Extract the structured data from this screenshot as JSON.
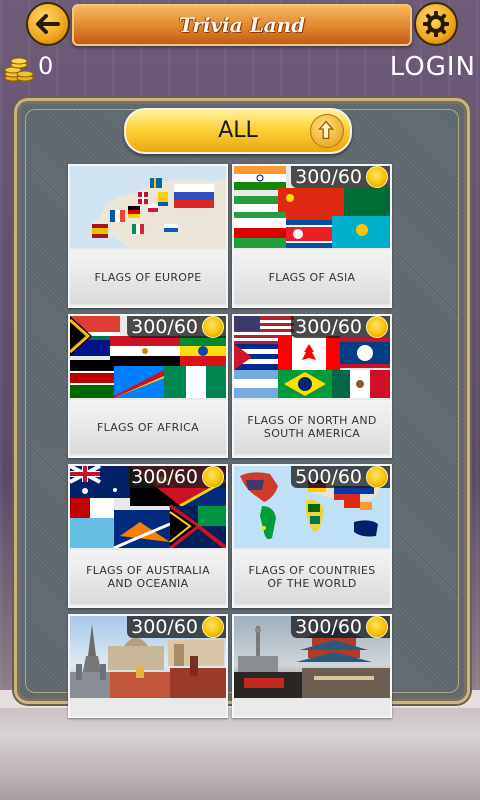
{
  "header": {
    "title": "Trivia Land",
    "coins": "0",
    "login_label": "LOGIN"
  },
  "filter": {
    "all_label": "ALL"
  },
  "cards": [
    {
      "label": "FLAGS OF EUROPE",
      "price": ""
    },
    {
      "label": "FLAGS OF ASIA",
      "price": "300/60"
    },
    {
      "label": "FLAGS OF AFRICA",
      "price": "300/60"
    },
    {
      "label": "FLAGS OF NORTH AND SOUTH AMERICA",
      "price": "300/60"
    },
    {
      "label": "FLAGS OF AUSTRALIA AND OCEANIA",
      "price": "300/60"
    },
    {
      "label": "FLAGS OF COUNTRIES OF THE WORLD",
      "price": "500/60"
    },
    {
      "label": "",
      "price": "300/60"
    },
    {
      "label": "",
      "price": "300/60"
    }
  ],
  "colors": {
    "accent": "#f1a51c",
    "banner": "#e0862d",
    "panel": "#5f6970"
  },
  "icons": [
    "back-arrow-icon",
    "gear-icon",
    "coin-stack-icon",
    "up-arrow-icon",
    "coin-icon"
  ]
}
